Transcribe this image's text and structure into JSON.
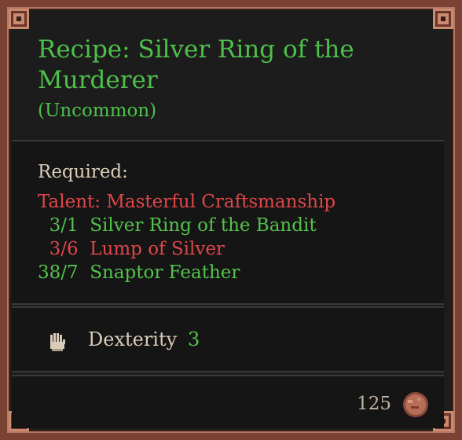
{
  "tooltip": {
    "title": "Recipe: Silver Ring of the Murderer",
    "rarity": "(Uncommon)",
    "required_label": "Required:",
    "requirements": [
      {
        "text": "Talent: Masterful Craftsmanship",
        "status": "missing",
        "color": "#e0464a"
      },
      {
        "text": "  3/1  Silver Ring of the Bandit",
        "status": "met",
        "color": "#53c24c"
      },
      {
        "text": "  3/6  Lump of Silver",
        "status": "missing",
        "color": "#e0464a"
      },
      {
        "text": "38/7  Snaptor Feather",
        "status": "met",
        "color": "#53c24c"
      }
    ],
    "stat": {
      "icon": "hand-icon",
      "name": "Dexterity",
      "value": "3"
    },
    "price": {
      "value": "125",
      "icon": "coin-icon"
    },
    "colors": {
      "title": "#4cc04a",
      "frame": "#7a4232",
      "text": "#d9ccb8"
    }
  }
}
